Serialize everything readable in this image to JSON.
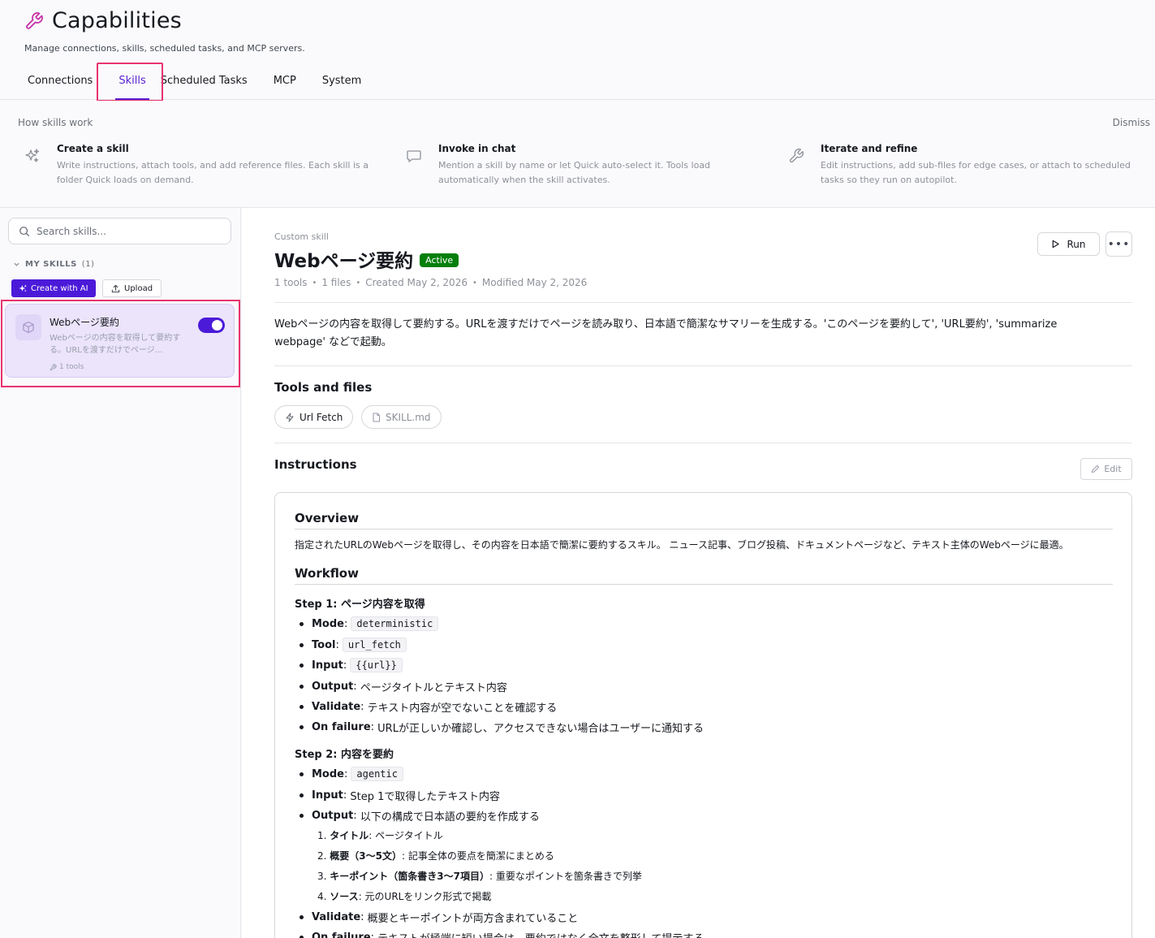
{
  "header": {
    "title": "Capabilities",
    "subtitle": "Manage connections, skills, scheduled tasks, and MCP servers.",
    "tabs": [
      {
        "label": "Connections"
      },
      {
        "label": "Skills"
      },
      {
        "label": "Scheduled Tasks"
      },
      {
        "label": "MCP"
      },
      {
        "label": "System"
      }
    ],
    "active_tab": "Skills"
  },
  "how": {
    "title": "How skills work",
    "dismiss": "Dismiss",
    "cards": [
      {
        "icon": "sparkle-icon",
        "title": "Create a skill",
        "desc": "Write instructions, attach tools, and add reference files. Each skill is a folder Quick loads on demand."
      },
      {
        "icon": "chat-bubble-icon",
        "title": "Invoke in chat",
        "desc": "Mention a skill by name or let Quick auto-select it. Tools load automatically when the skill activates."
      },
      {
        "icon": "wrench-icon",
        "title": "Iterate and refine",
        "desc": "Edit instructions, add sub-files for edge cases, or attach to scheduled tasks so they run on autopilot."
      }
    ]
  },
  "sidebar": {
    "search_placeholder": "Search skills...",
    "my_skills_label": "MY SKILLS",
    "my_skills_count": "(1)",
    "create_label": "Create with AI",
    "upload_label": "Upload",
    "skills": [
      {
        "name": "Webページ要約",
        "desc": "Webページの内容を取得して要約する。URLを渡すだけでページ…",
        "tools": "1 tools",
        "enabled": true
      }
    ]
  },
  "detail": {
    "kicker": "Custom skill",
    "title": "Webページ要約",
    "status": "Active",
    "meta": [
      "1 tools",
      "1 files",
      "Created May 2, 2026",
      "Modified May 2, 2026"
    ],
    "run_label": "Run",
    "more_label": "•••",
    "description": "Webページの内容を取得して要約する。URLを渡すだけでページを読み取り、日本語で簡潔なサマリーを生成する。'このページを要約して', 'URL要約', 'summarize webpage' などで起動。",
    "tools_heading": "Tools and files",
    "tools": [
      {
        "label": "Url Fetch",
        "icon": "bolt-icon"
      },
      {
        "label": "SKILL.md",
        "icon": "file-icon"
      }
    ],
    "instructions_heading": "Instructions",
    "edit_label": "Edit",
    "doc": {
      "overview_h": "Overview",
      "overview_p": "指定されたURLのWebページを取得し、その内容を日本語で簡潔に要約するスキル。 ニュース記事、ブログ投稿、ドキュメントページなど、テキスト主体のWebページに最適。",
      "workflow_h": "Workflow",
      "step1_h": "Step 1: ページ内容を取得",
      "step1": [
        {
          "k": "Mode",
          "code": "deterministic"
        },
        {
          "k": "Tool",
          "code": "url_fetch"
        },
        {
          "k": "Input",
          "code": "{{url}}"
        },
        {
          "k": "Output",
          "v": "ページタイトルとテキスト内容"
        },
        {
          "k": "Validate",
          "v": "テキスト内容が空でないことを確認する"
        },
        {
          "k": "On failure",
          "v": "URLが正しいか確認し、アクセスできない場合はユーザーに通知する"
        }
      ],
      "step2_h": "Step 2: 内容を要約",
      "step2": [
        {
          "k": "Mode",
          "code": "agentic"
        },
        {
          "k": "Input",
          "v": "Step 1で取得したテキスト内容"
        },
        {
          "k": "Output",
          "v": "以下の構成で日本語の要約を作成する"
        }
      ],
      "ordered": [
        {
          "n": "1.",
          "k": "タイトル",
          "v": ": ページタイトル"
        },
        {
          "n": "2.",
          "k": "概要（3〜5文）",
          "v": ": 記事全体の要点を簡潔にまとめる"
        },
        {
          "n": "3.",
          "k": "キーポイント（箇条書き3〜7項目）",
          "v": ": 重要なポイントを箇条書きで列挙"
        },
        {
          "n": "4.",
          "k": "ソース",
          "v": ": 元のURLをリンク形式で掲載"
        }
      ],
      "step2_tail": [
        {
          "k": "Validate",
          "v": "概要とキーポイントが両方含まれていること"
        },
        {
          "k": "On failure",
          "v": "テキストが極端に短い場合は、要約ではなく全文を整形して提示する"
        }
      ]
    }
  },
  "colors": {
    "accent": "#5a1fd1",
    "primary_button": "#4b1ad9",
    "active_badge": "#037f0c",
    "highlight": "#e8336e"
  }
}
